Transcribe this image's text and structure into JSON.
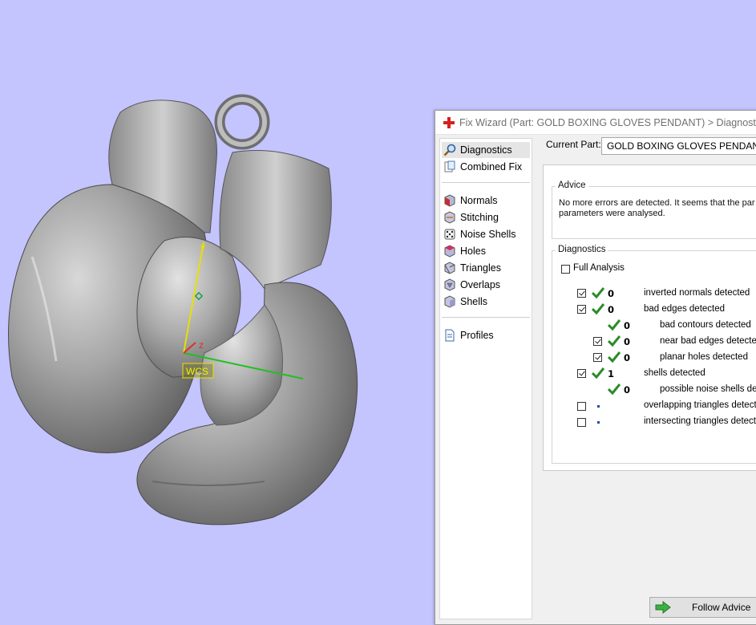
{
  "viewport": {
    "axes": {
      "y": "y",
      "z": "z",
      "wcs": "WCS"
    },
    "colors": {
      "background": "#c4c4ff",
      "model": "#9a9a9a",
      "y_axis": "#e8e000",
      "x_axis": "#20c020",
      "z_axis": "#e03020"
    }
  },
  "wizard": {
    "title": "Fix Wizard (Part: GOLD BOXING GLOVES PENDANT) > Diagnostics",
    "nav": [
      {
        "label": "Diagnostics",
        "icon": "magnifier-icon"
      },
      {
        "label": "Combined Fix",
        "icon": "combined-fix-icon"
      },
      {
        "label": "Normals",
        "icon": "normals-cube-icon"
      },
      {
        "label": "Stitching",
        "icon": "stitching-cube-icon"
      },
      {
        "label": "Noise Shells",
        "icon": "noise-shells-dice-icon"
      },
      {
        "label": "Holes",
        "icon": "holes-cube-icon"
      },
      {
        "label": "Triangles",
        "icon": "triangles-cube-icon"
      },
      {
        "label": "Overlaps",
        "icon": "overlaps-cube-icon"
      },
      {
        "label": "Shells",
        "icon": "shells-cube-icon"
      },
      {
        "label": "Profiles",
        "icon": "profiles-document-icon"
      }
    ],
    "current_part_label": "Current Part:",
    "current_part_value": "GOLD BOXING GLOVES PENDANT",
    "advice": {
      "title": "Advice",
      "line1": "No more errors are detected. It seems that the par",
      "line2": "parameters were analysed."
    },
    "diagnostics": {
      "title": "Diagnostics",
      "full_analysis": "Full Analysis",
      "rows": [
        {
          "count": "0",
          "label": "inverted normals detected"
        },
        {
          "count": "0",
          "label": "bad edges detected"
        },
        {
          "count": "0",
          "label": "bad contours detected"
        },
        {
          "count": "0",
          "label": "near bad edges detected"
        },
        {
          "count": "0",
          "label": "planar holes detected"
        },
        {
          "count": "1",
          "label": "shells detected"
        },
        {
          "count": "0",
          "label": "possible noise shells detec"
        },
        {
          "count": "",
          "label": "overlapping triangles detecte"
        },
        {
          "count": "",
          "label": "intersecting triangles detecte"
        }
      ]
    },
    "follow_advice": "Follow Advice",
    "colors": {
      "check_green": "#2a8a2a",
      "title_red": "#d62020"
    }
  }
}
